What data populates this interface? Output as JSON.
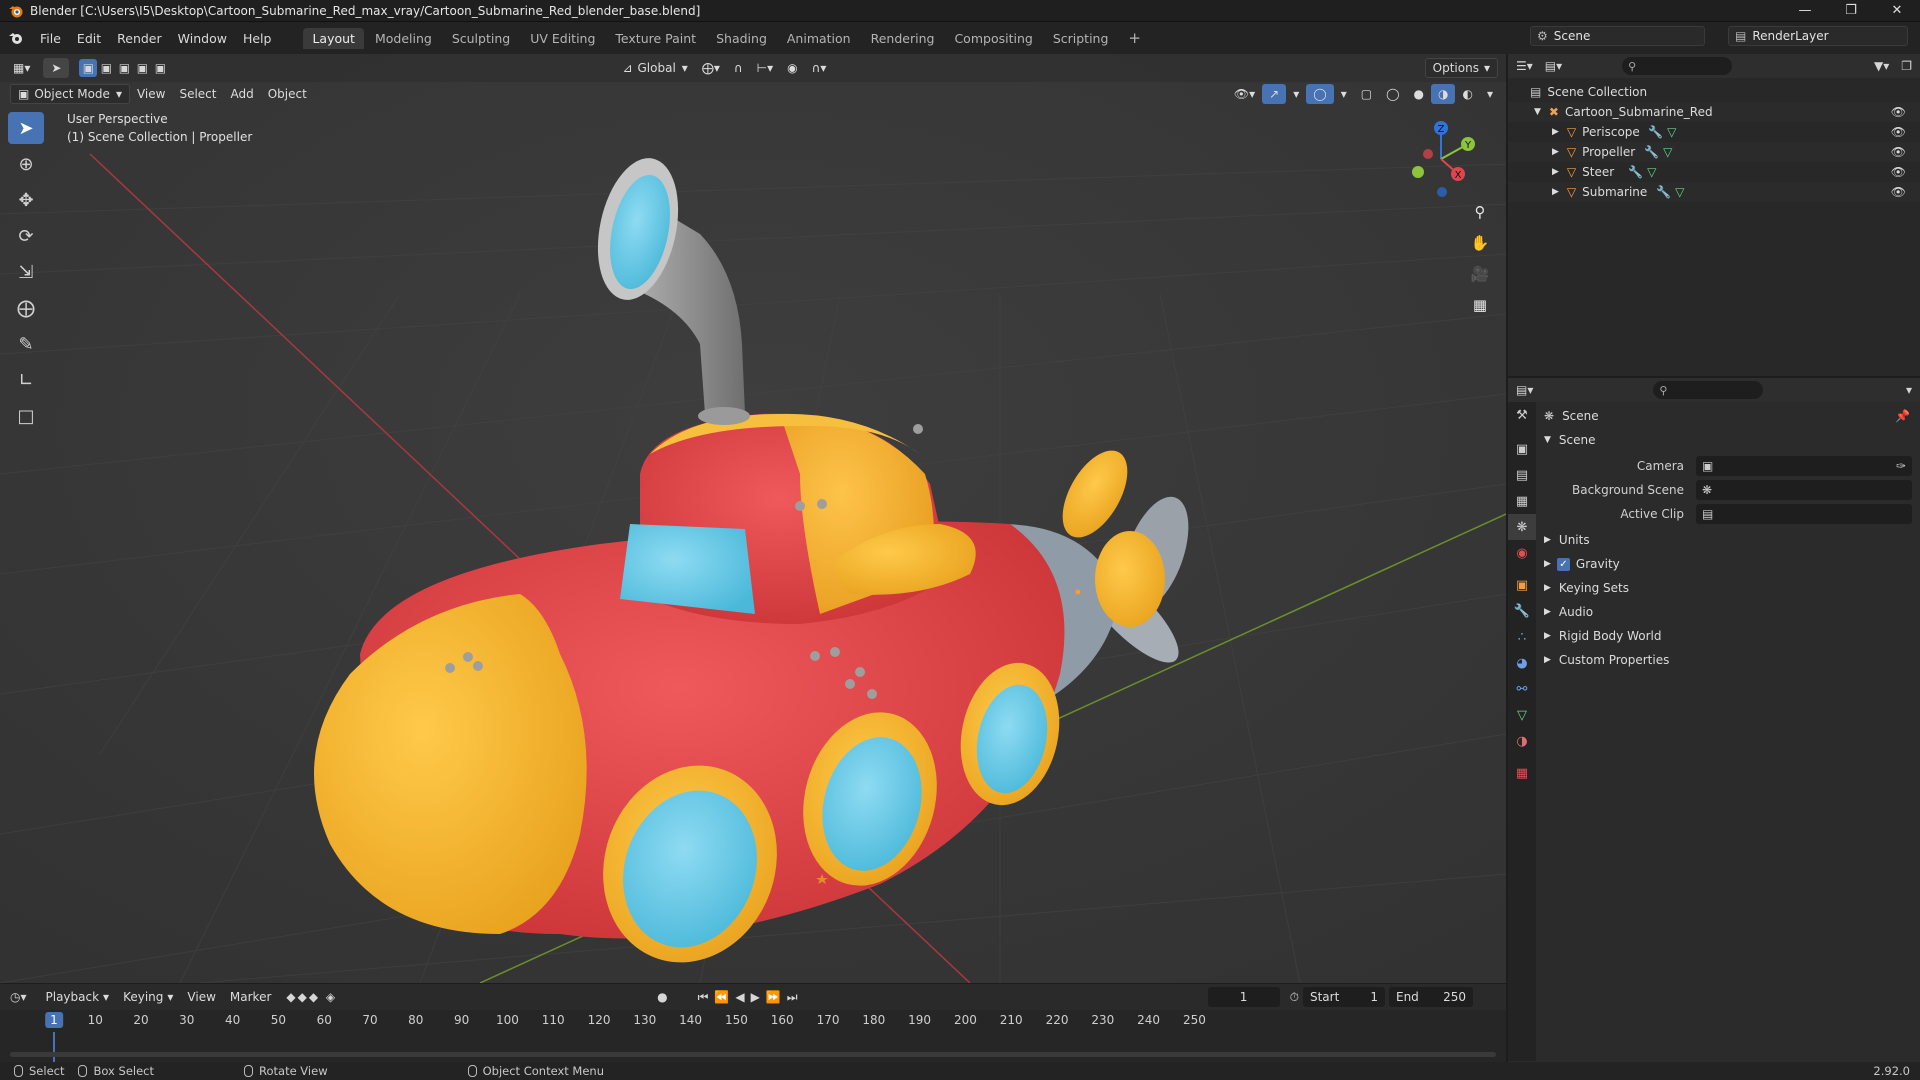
{
  "window": {
    "title": "Blender [C:\\Users\\I5\\Desktop\\Cartoon_Submarine_Red_max_vray/Cartoon_Submarine_Red_blender_base.blend]"
  },
  "menu": {
    "items": [
      "File",
      "Edit",
      "Render",
      "Window",
      "Help"
    ],
    "workspaces": [
      "Layout",
      "Modeling",
      "Sculpting",
      "UV Editing",
      "Texture Paint",
      "Shading",
      "Animation",
      "Rendering",
      "Compositing",
      "Scripting"
    ],
    "active_workspace": "Layout",
    "scene_name": "Scene",
    "render_layer": "RenderLayer"
  },
  "viewport": {
    "mode": "Object Mode",
    "menus": [
      "View",
      "Select",
      "Add",
      "Object"
    ],
    "transform_orientation": "Global",
    "options_label": "Options",
    "info_line1": "User Perspective",
    "info_line2": "(1) Scene Collection | Propeller",
    "gizmo_axes": [
      "X",
      "Y",
      "Z"
    ]
  },
  "outliner": {
    "root": "Scene Collection",
    "collection": "Cartoon_Submarine_Red",
    "objects": [
      "Periscope",
      "Propeller",
      "Steer",
      "Submarine"
    ]
  },
  "properties": {
    "header": "Scene",
    "panel_title": "Scene",
    "fields": [
      {
        "label": "Camera",
        "value": ""
      },
      {
        "label": "Background Scene",
        "value": ""
      },
      {
        "label": "Active Clip",
        "value": ""
      }
    ],
    "sections": [
      "Units",
      "Gravity",
      "Keying Sets",
      "Audio",
      "Rigid Body World",
      "Custom Properties"
    ],
    "gravity_checked": true
  },
  "timeline": {
    "menus": [
      "Playback",
      "Keying",
      "View",
      "Marker"
    ],
    "current_frame": "1",
    "start_label": "Start",
    "start_value": "1",
    "end_label": "End",
    "end_value": "250",
    "ticks": [
      "10",
      "20",
      "30",
      "40",
      "50",
      "60",
      "70",
      "80",
      "90",
      "100",
      "110",
      "120",
      "130",
      "140",
      "150",
      "160",
      "170",
      "180",
      "190",
      "200",
      "210",
      "220",
      "230",
      "240",
      "250"
    ]
  },
  "statusbar": {
    "select": "Select",
    "box_select": "Box Select",
    "rotate_view": "Rotate View",
    "context_menu": "Object Context Menu",
    "version": "2.92.0"
  },
  "colors": {
    "accent": "#4772b3",
    "sub_red": "#e4474b",
    "sub_yellow": "#f5b731",
    "window_blue": "#68c9e5",
    "prop_grey": "#9aa4ad"
  }
}
